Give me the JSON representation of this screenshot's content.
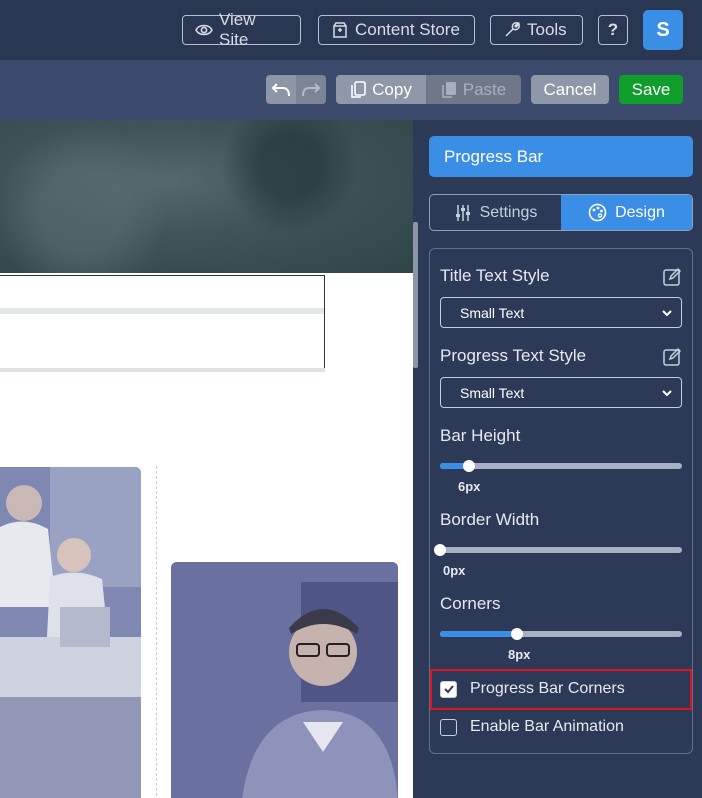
{
  "topbar": {
    "view_site": "View Site",
    "content_store": "Content Store",
    "tools": "Tools",
    "help": "?",
    "avatar_initial": "S"
  },
  "actions": {
    "copy": "Copy",
    "paste": "Paste",
    "cancel": "Cancel",
    "save": "Save"
  },
  "panel": {
    "title": "Progress Bar",
    "tabs": [
      {
        "label": "Settings",
        "active": false
      },
      {
        "label": "Design",
        "active": true
      }
    ],
    "title_text_style": {
      "label": "Title Text Style",
      "value": "Small Text"
    },
    "progress_text_style": {
      "label": "Progress Text Style",
      "value": "Small Text"
    },
    "bar_height": {
      "label": "Bar Height",
      "value": 6,
      "display": "6px",
      "fraction": 0.12
    },
    "border_width": {
      "label": "Border Width",
      "value": 0,
      "display": "0px",
      "fraction": 0.0
    },
    "corners": {
      "label": "Corners",
      "value": 8,
      "display": "8px",
      "fraction": 0.32
    },
    "progress_bar_corners": {
      "label": "Progress Bar Corners",
      "checked": true
    },
    "enable_bar_animation": {
      "label": "Enable Bar Animation",
      "checked": false
    }
  },
  "colors": {
    "accent": "#3a8ee6",
    "save": "#0f9d2c",
    "highlight": "#e0141b"
  }
}
